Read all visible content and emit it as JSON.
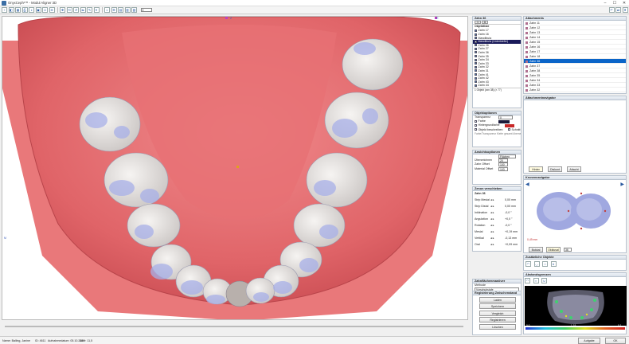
{
  "window": {
    "title": "OnyxCeph³™ - Modul Aligner 3D",
    "ctl_min": "–",
    "ctl_max": "☐",
    "ctl_close": "✕"
  },
  "toolbar": {
    "icons": [
      "+",
      "◧",
      "▦",
      "⎙",
      "◑",
      "▣",
      "☐",
      "⊕",
      "✥",
      "⟲",
      "↺",
      "⇆",
      "✎",
      "⌖",
      "◐",
      "⚙",
      "▤",
      "▥",
      "▧"
    ],
    "zoom_value": "0",
    "right_icons": [
      "↶",
      "⇄",
      "⬆"
    ]
  },
  "viewport": {
    "top_marker": "Z",
    "left_marker": "M",
    "right_marker": "R"
  },
  "objects_panel": {
    "header": "Zahn 36",
    "tabs": [
      "1",
      "A"
    ],
    "title": "Objektliste",
    "items": [
      {
        "label": "Zahn 17",
        "checked": true
      },
      {
        "label": "Zahn 16",
        "checked": true
      },
      {
        "label": "Mandibula",
        "checked": true
      },
      {
        "label": "Mandibula (Unterkiefer)",
        "checked": false,
        "selected": true
      },
      {
        "label": "Zahn 26",
        "checked": true
      },
      {
        "label": "Zahn 27",
        "checked": true
      },
      {
        "label": "Zahn 36",
        "checked": true
      },
      {
        "label": "Zahn 35",
        "checked": true
      },
      {
        "label": "Zahn 34",
        "checked": true
      },
      {
        "label": "Zahn 33",
        "checked": true
      },
      {
        "label": "Zahn 32",
        "checked": true
      },
      {
        "label": "Zahn 31",
        "checked": true
      },
      {
        "label": "Zahn 41",
        "checked": true
      },
      {
        "label": "Zahn 42",
        "checked": true
      },
      {
        "label": "Zahn 43",
        "checked": true
      },
      {
        "label": "Zahn 44",
        "checked": true
      },
      {
        "label": "Zahn 45",
        "checked": true
      },
      {
        "label": "Zahn 46",
        "checked": true
      },
      {
        "label": "Zahn 47",
        "checked": true
      }
    ],
    "footer": "1 Objekt (von 38) (× 77)"
  },
  "props_panel": {
    "title": "Objektoptionen",
    "transparency_label": "Transparenz",
    "transparency_value": "0",
    "color_label": "Farbe",
    "bg_color_label": "Hintergrundfarbe",
    "color_swatch": "#1a1a3a",
    "bg_swatch": "#c82828",
    "show_edge_label": "Objekt beschreiben",
    "edge_label": "Schnitt",
    "note": "Farbe/Transparenz Kiefer gesamt übernehmen"
  },
  "view_panel": {
    "title": "Ansichtsoptionen",
    "mode_label": "Flächen",
    "smooth_label": "Überzeichnen",
    "smooth_value": "20",
    "shift_label": "Zahn Offset",
    "shift_value": "100",
    "mat_label": "Material Offset",
    "mat_value": "103"
  },
  "measure_panel": {
    "title": "Zenon verschieben",
    "tooth": "Zahn 36",
    "rows": [
      {
        "label": "Strip Mesial",
        "value": "0,00 mm"
      },
      {
        "label": "Strip Distal",
        "value": "0,00 mm"
      },
      {
        "label": "Inklination",
        "value": "-0,0 °"
      },
      {
        "label": "Angulation",
        "value": "+0,0 °"
      },
      {
        "label": "Rotation",
        "value": "-0,0 °"
      },
      {
        "label": "Mesial",
        "value": "+0,19 mm"
      },
      {
        "label": "Vertikal",
        "value": "-0,13 mm"
      },
      {
        "label": "Oral",
        "value": "+0,09 mm"
      }
    ]
  },
  "segment_panel": {
    "title": "Zahnflächenmanöver",
    "method_label": "Methode",
    "method_value": "Vorschubstufe",
    "check_label": "Automatisch aktualisieren",
    "btn_update": "Aktualisieren",
    "btn_reset": "Fr. Zurücksetzen"
  },
  "register_panel": {
    "title": "Registrierung Zwischenstand",
    "buttons": [
      "Laden",
      "Speichern",
      "Vergleich",
      "Registrieren",
      "Löschen"
    ]
  },
  "list_panel": {
    "title": "Attachments",
    "items": [
      {
        "label": "Zahn 11",
        "color": "#b07090"
      },
      {
        "label": "Zahn 12",
        "color": "#b07090"
      },
      {
        "label": "Zahn 13",
        "color": "#b07090"
      },
      {
        "label": "Zahn 14",
        "color": "#b07090"
      },
      {
        "label": "Zahn 15",
        "color": "#b07090"
      },
      {
        "label": "Zahn 16",
        "color": "#b07090"
      },
      {
        "label": "Zahn 17",
        "color": "#b07090"
      },
      {
        "label": "Zahn 18",
        "color": "#b07090"
      },
      {
        "label": "Zahn 36",
        "color": "#b07090",
        "selected": true
      },
      {
        "label": "Zahn 37",
        "color": "#b07090"
      },
      {
        "label": "Zahn 38",
        "color": "#b07090"
      },
      {
        "label": "Zahn 35",
        "color": "#b07090"
      },
      {
        "label": "Zahn 34",
        "color": "#b07090"
      },
      {
        "label": "Zahn 33",
        "color": "#b07090"
      },
      {
        "label": "Zahn 32",
        "color": "#b07090"
      }
    ]
  },
  "attach_panel": {
    "title": "Attachmentnavigator",
    "btn_a": "Hinter",
    "btn_b": "Diskont",
    "btn_c": "Attacht"
  },
  "nav_panel": {
    "title": "Kronennavigator",
    "readout": "0,49 mm",
    "btn_a": "Bukkal",
    "btn_b": "Okklusal",
    "field": "36"
  },
  "extra_panel": {
    "title": "Zusätzliche Objekte"
  },
  "heatmap_panel": {
    "title": "Abstandsgrenzen",
    "scale_left": "0,0",
    "scale_mid": "-1,19",
    "scale_right": "0,1"
  },
  "status": {
    "patient": "Name: Balling, Janine",
    "id": "ID: 4611",
    "date": "Aufnahmedatum: 05.10.2017",
    "alter": "Alter: 11,5",
    "right_label": "Aufgabe",
    "ok_label": "OK"
  },
  "colors": {
    "gum": "#e06468",
    "tooth": "#e6e2e0",
    "attach": "#a8b0e8"
  }
}
